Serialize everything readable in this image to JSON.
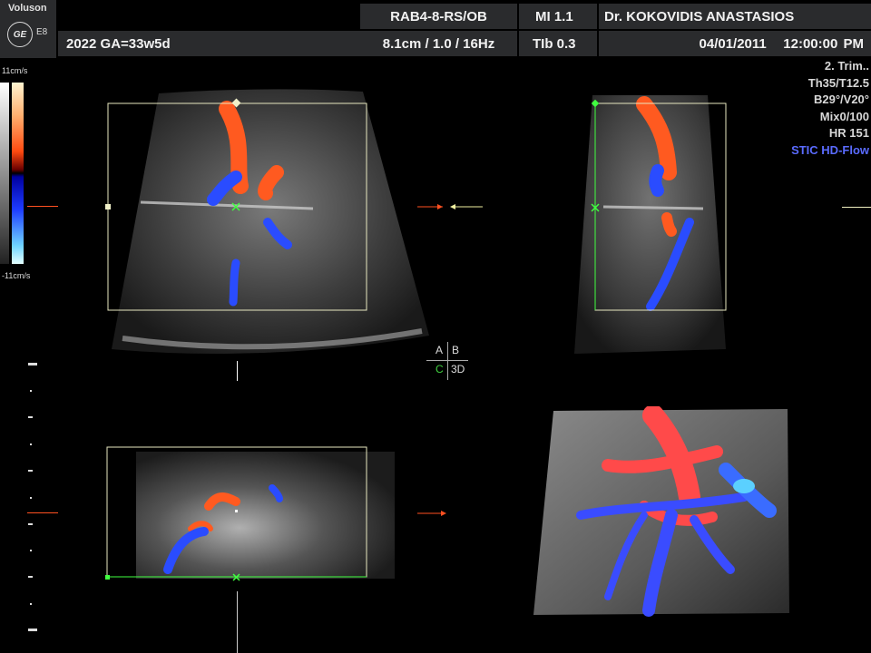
{
  "header": {
    "brand": "Voluson",
    "logo": "GE",
    "model": "E8",
    "probe": "RAB4-8-RS/OB",
    "mi": "MI  1.1",
    "operator": "Dr. KOKOVIDIS ANASTASIOS",
    "patient": "2022  GA=33w5d",
    "depth": "8.1cm / 1.0 / 16Hz",
    "tib": "TIb  0.3",
    "date": "04/01/2011",
    "time": "12:00:00 PM"
  },
  "info_panel": {
    "trimester": "2. Trim..",
    "th": "Th35/T12.5",
    "angle": "B29°/V20°",
    "mix": "Mix0/100",
    "hr": "HR 151",
    "mode": "STIC HD-Flow"
  },
  "color_scale": {
    "top": "11cm/s",
    "bottom": "-11cm/s"
  },
  "orientation": {
    "a": "A",
    "b": "B",
    "c": "C",
    "d": "3D"
  },
  "colors": {
    "header_bg": "#2a2b2d",
    "flow_label": "#5a6bff",
    "doppler_red": "#ff5a20",
    "doppler_blue": "#2a4cff"
  }
}
